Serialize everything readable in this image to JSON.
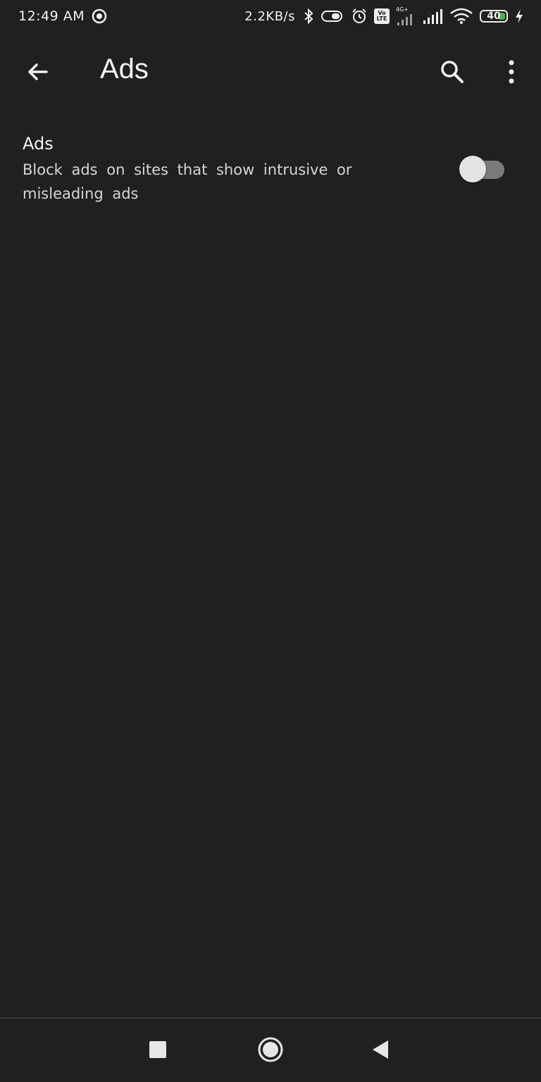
{
  "status_bar": {
    "time": "12:49 AM",
    "network_speed": "2.2KB/s",
    "volte_top": "Vo",
    "volte_bottom": "LTE",
    "network_type": "4G+",
    "battery_level": "40",
    "icons": [
      "media-icon",
      "bluetooth-icon",
      "vibrate-icon",
      "alarm-icon",
      "volte-icon",
      "signal-icon",
      "signal-icon",
      "wifi-icon",
      "battery-icon",
      "charging-icon"
    ]
  },
  "app_bar": {
    "title": "Ads",
    "back_icon": "arrow-back-icon",
    "search_icon": "search-icon",
    "menu_icon": "more-vert-icon"
  },
  "setting": {
    "title": "Ads",
    "summary": "Block ads on sites that show intrusive or misleading ads",
    "toggle_on": false
  },
  "nav_bar": {
    "icons": [
      "recents-icon",
      "home-icon",
      "back-icon"
    ]
  },
  "colors": {
    "background": "#202020",
    "text_primary": "#f2f2f2",
    "text_secondary": "#d6d6d6",
    "toggle_track": "#7a7a7a",
    "toggle_thumb": "#e3e3e3",
    "battery_fill": "#4caf50"
  }
}
